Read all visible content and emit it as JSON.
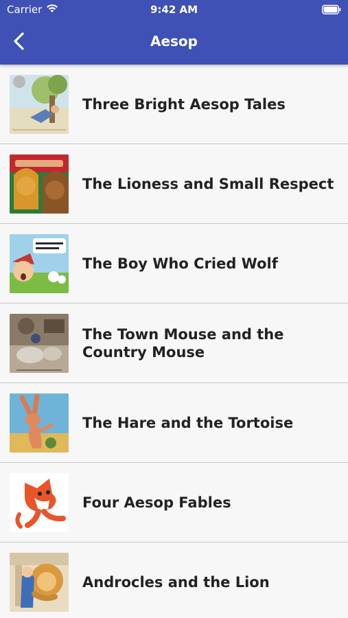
{
  "status_bar": {
    "carrier": "Carrier",
    "time": "9:42 AM"
  },
  "header": {
    "title": "Aesop",
    "back_icon": "chevron-left-icon"
  },
  "colors": {
    "app_bar": "#3f51b5",
    "background": "#f7f7f7",
    "divider": "#c8c8c8",
    "text": "#222222"
  },
  "items": [
    {
      "title": "Three Bright Aesop Tales"
    },
    {
      "title": "The Lioness and Small Respect"
    },
    {
      "title": "The Boy Who Cried Wolf"
    },
    {
      "title": "The Town Mouse and the Country Mouse"
    },
    {
      "title": "The Hare and the Tortoise"
    },
    {
      "title": "Four Aesop Fables"
    },
    {
      "title": "Androcles and the Lion"
    }
  ]
}
